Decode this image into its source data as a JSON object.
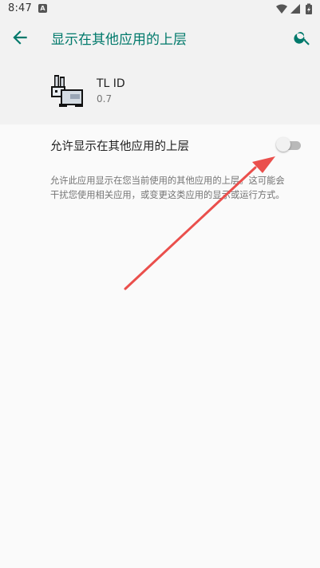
{
  "status_bar": {
    "time": "8:47",
    "notification_glyph": "A",
    "icons": [
      "wifi-icon",
      "signal-icon",
      "battery-charging-icon"
    ]
  },
  "app_bar": {
    "title": "显示在其他应用的上层",
    "back_icon": "arrow-left-icon",
    "search_icon": "search-icon"
  },
  "app_header": {
    "icon": "rabbit-icon",
    "name": "TL ID",
    "version": "0.7"
  },
  "preference": {
    "label": "允许显示在其他应用的上层",
    "enabled": false
  },
  "summary": "允许此应用显示在您当前使用的其他应用的上层。这可能会干扰您使用相关应用，或变更这类应用的显示或运行方式。",
  "annotation": {
    "type": "arrow",
    "color": "#ea4f4c",
    "points_to": "permission-switch"
  },
  "colors": {
    "accent": "#00796b",
    "header_bg": "#f2f2f2",
    "page_bg": "#fafafa"
  }
}
